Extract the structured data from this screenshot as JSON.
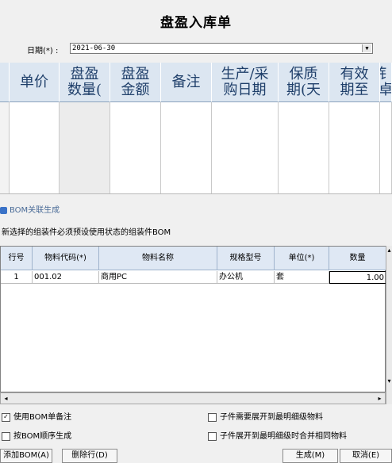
{
  "title": "盘盈入库单",
  "date": {
    "label": "日期(*) :",
    "value": "2021-06-30"
  },
  "grid": {
    "columns": [
      "单价",
      "盘盈\n数量(",
      "盘盈\n金额",
      "备注",
      "生产/采\n购日期",
      "保质\n期(天",
      "有效\n期至",
      "钅\n卓"
    ]
  },
  "bom_section": {
    "header": "BOM关联生成",
    "hint": "新选择的组装件必须预设使用状态的组装件BOM"
  },
  "bom_table": {
    "columns": [
      "行号",
      "物料代码(*)",
      "物料名称",
      "规格型号",
      "单位(*)",
      "数量"
    ],
    "rows": [
      [
        "1",
        "001.02",
        "商用PC",
        "办公机",
        "套",
        "1.00"
      ]
    ]
  },
  "options": {
    "use_bom_note": {
      "label": "使用BOM单备注",
      "checked": true
    },
    "by_bom_order": {
      "label": "按BOM顺序生成",
      "checked": false
    },
    "expand_finest": {
      "label": "子件需要展开到最明细级物料",
      "checked": false
    },
    "merge_same": {
      "label": "子件展开到最明细级时合并相同物料",
      "checked": false
    }
  },
  "buttons": {
    "add_bom": "添加BOM(A)",
    "delete_row": "删除行(D)",
    "generate": "生成(M)",
    "cancel": "取消(E)"
  }
}
